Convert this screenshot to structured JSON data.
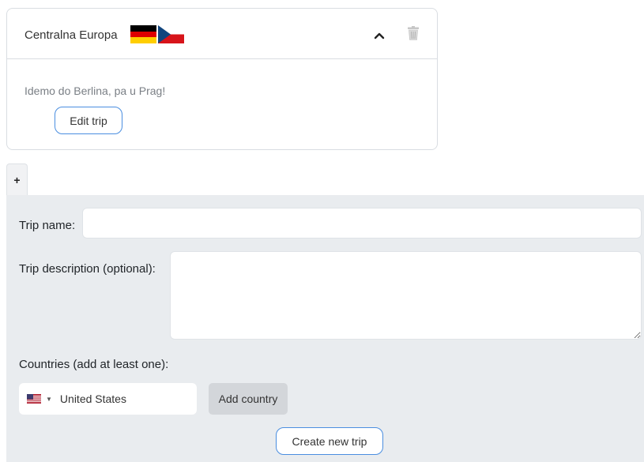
{
  "trip": {
    "title": "Centralna Europa",
    "flags": [
      "germany-flag-icon",
      "czech-flag-icon"
    ],
    "description": "Idemo do Berlina, pa u Prag!",
    "edit_label": "Edit trip"
  },
  "tab": {
    "label": "+"
  },
  "form": {
    "name_label": "Trip name:",
    "name_value": "",
    "description_label": "Trip description (optional):",
    "description_value": "",
    "countries_label": "Countries (add at least one):",
    "selected_country": "United States",
    "selected_country_flag": "us-flag-icon",
    "add_country_label": "Add country",
    "create_label": "Create new trip"
  },
  "colors": {
    "accent_border": "#4a8ee0",
    "panel_bg": "#e9ecef",
    "add_button_bg": "#d3d6da"
  }
}
